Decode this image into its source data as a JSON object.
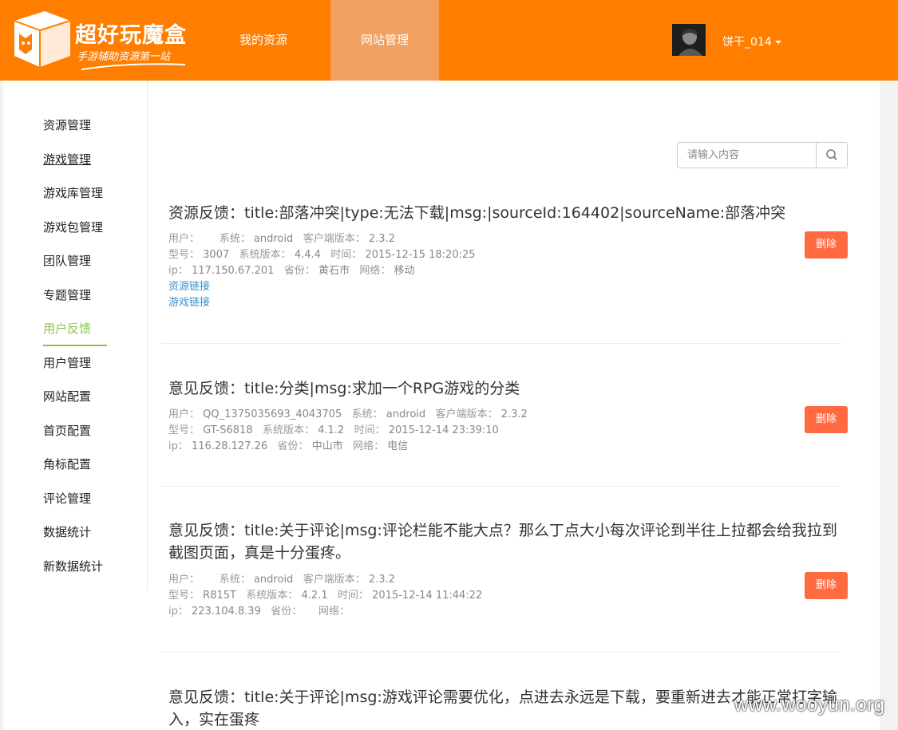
{
  "header": {
    "logo_title": "超好玩魔盒",
    "logo_subtitle": "手游辅助资源第一站",
    "nav": [
      "我的资源",
      "网站管理"
    ],
    "username": "饼干_014"
  },
  "sidebar": {
    "items": [
      "资源管理",
      "游戏管理",
      "游戏库管理",
      "游戏包管理",
      "团队管理",
      "专题管理",
      "用户反馈",
      "用户管理",
      "网站配置",
      "首页配置",
      "角标配置",
      "评论管理",
      "数据统计",
      "新数据统计"
    ],
    "active": "用户反馈",
    "hovered": "游戏管理"
  },
  "search": {
    "placeholder": "请输入内容",
    "value": ""
  },
  "labels": {
    "user": "用户：",
    "system": "系统：",
    "client_version": "客户端版本：",
    "model": "型号：",
    "os_version": "系统版本：",
    "time": "时间：",
    "ip": "ip：",
    "province": "省份：",
    "network": "网络：",
    "delete": "删除"
  },
  "feedback": [
    {
      "title": "资源反馈：title:部落冲突|type:无法下载|msg:|sourceId:164402|sourceName:部落冲突",
      "user": "",
      "system": "android",
      "client_version": "2.3.2",
      "model": "3007",
      "os_version": "4.4.4",
      "time": "2015-12-15 18:20:25",
      "ip": "117.150.67.201",
      "province": "黄石市",
      "network": "移动",
      "links": [
        "资源链接",
        "游戏链接"
      ]
    },
    {
      "title": "意见反馈：title:分类|msg:求加一个RPG游戏的分类",
      "user": "QQ_1375035693_4043705",
      "system": "android",
      "client_version": "2.3.2",
      "model": "GT-S6818",
      "os_version": "4.1.2",
      "time": "2015-12-14 23:39:10",
      "ip": "116.28.127.26",
      "province": "中山市",
      "network": "电信",
      "links": []
    },
    {
      "title": "意见反馈：title:关于评论|msg:评论栏能不能大点？那么丁点大小每次评论到半往上拉都会给我拉到截图页面，真是十分蛋疼。",
      "user": "",
      "system": "android",
      "client_version": "2.3.2",
      "model": "R815T",
      "os_version": "4.2.1",
      "time": "2015-12-14 11:44:22",
      "ip": "223.104.8.39",
      "province": "",
      "network": "",
      "links": []
    },
    {
      "title": "意见反馈：title:关于评论|msg:游戏评论需要优化，点进去永远是下载，要重新进去才能正常打字输入，实在蛋疼",
      "links": []
    }
  ],
  "watermark": "www.wooyun.org",
  "colors": {
    "header": "#ff7e00",
    "active_nav": "#f2a060",
    "active_side": "#8bc34a",
    "delete": "#ff6a41",
    "link": "#3a8fd0"
  }
}
